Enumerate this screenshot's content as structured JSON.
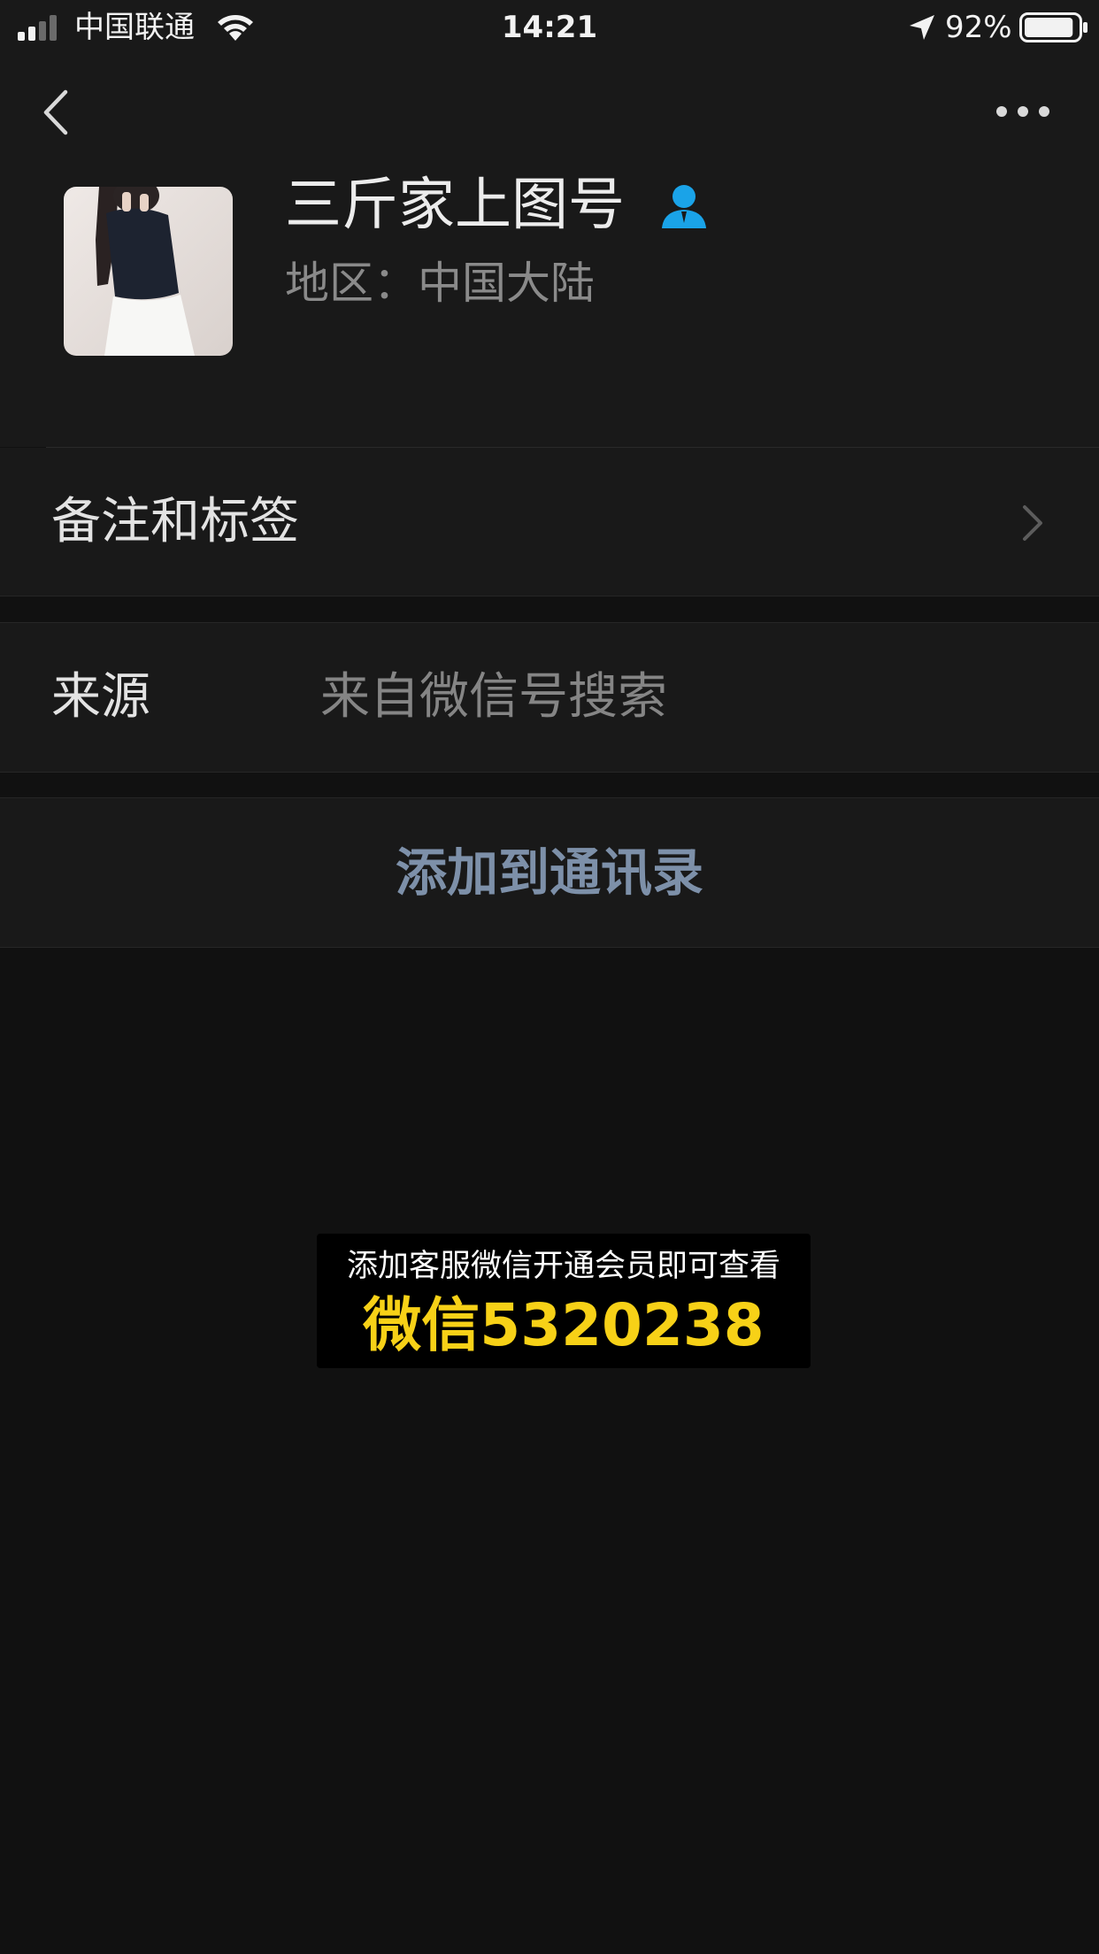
{
  "colors": {
    "background": "#111111",
    "cell_background": "#191919",
    "link_blue": "#7d90a9",
    "promo_yellow": "#f7d117",
    "contact_icon_blue": "#1aa3e8"
  },
  "status_bar": {
    "carrier": "中国联通",
    "time": "14:21",
    "battery_percent": "92%",
    "battery_level": 0.92,
    "icons": [
      "signal-icon",
      "wifi-icon",
      "location-arrow-icon",
      "battery-icon"
    ]
  },
  "nav": {
    "back_icon": "chevron-left-icon",
    "more_icon": "more-dots-icon"
  },
  "profile": {
    "name": "三斤家上图号",
    "badge_icon": "contact-person-icon",
    "region_label": "地区：",
    "region_value": "中国大陆"
  },
  "cells": {
    "tags": {
      "label": "备注和标签",
      "icon": "chevron-right-icon"
    },
    "source": {
      "label": "来源",
      "value": "来自微信号搜索"
    },
    "add_contact": {
      "label": "添加到通讯录"
    }
  },
  "promo": {
    "line1": "添加客服微信开通会员即可查看",
    "line2": "微信5320238"
  }
}
